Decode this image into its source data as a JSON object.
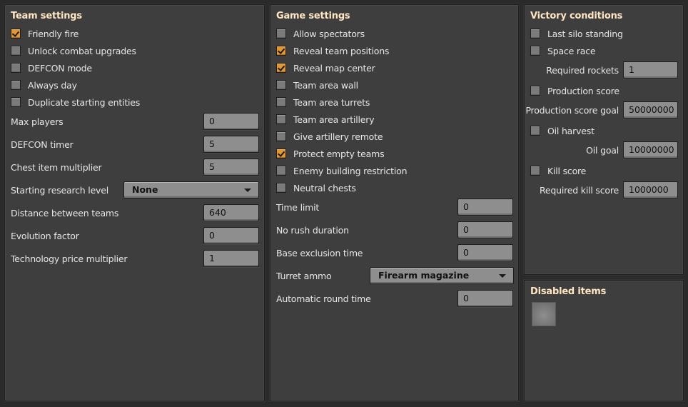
{
  "team_settings": {
    "title": "Team settings",
    "checkboxes": [
      {
        "label": "Friendly fire",
        "checked": true
      },
      {
        "label": "Unlock combat upgrades",
        "checked": false
      },
      {
        "label": "DEFCON mode",
        "checked": false
      },
      {
        "label": "Always day",
        "checked": false
      },
      {
        "label": "Duplicate starting entities",
        "checked": false
      }
    ],
    "fields": [
      {
        "label": "Max players",
        "value": "0"
      },
      {
        "label": "DEFCON timer",
        "value": "5"
      },
      {
        "label": "Chest item multiplier",
        "value": "5"
      },
      {
        "label": "Starting research level",
        "value": "None",
        "type": "dropdown"
      },
      {
        "label": "Distance between teams",
        "value": "640"
      },
      {
        "label": "Evolution factor",
        "value": "0"
      },
      {
        "label": "Technology price multiplier",
        "value": "1"
      }
    ]
  },
  "game_settings": {
    "title": "Game settings",
    "checkboxes": [
      {
        "label": "Allow spectators",
        "checked": false
      },
      {
        "label": "Reveal team positions",
        "checked": true
      },
      {
        "label": "Reveal map center",
        "checked": true
      },
      {
        "label": "Team area wall",
        "checked": false
      },
      {
        "label": "Team area turrets",
        "checked": false
      },
      {
        "label": "Team area artillery",
        "checked": false
      },
      {
        "label": "Give artillery remote",
        "checked": false
      },
      {
        "label": "Protect empty teams",
        "checked": true
      },
      {
        "label": "Enemy building restriction",
        "checked": false
      },
      {
        "label": "Neutral chests",
        "checked": false
      }
    ],
    "fields": [
      {
        "label": "Time limit",
        "value": "0"
      },
      {
        "label": "No rush duration",
        "value": "0"
      },
      {
        "label": "Base exclusion time",
        "value": "0"
      },
      {
        "label": "Turret ammo",
        "value": "Firearm magazine",
        "type": "dropdown"
      },
      {
        "label": "Automatic round time",
        "value": "0"
      }
    ]
  },
  "victory_conditions": {
    "title": "Victory conditions",
    "last_silo": {
      "label": "Last silo standing",
      "checked": false
    },
    "space_race": {
      "label": "Space race",
      "checked": false
    },
    "required_rockets": {
      "label": "Required rockets",
      "value": "1"
    },
    "production_score": {
      "label": "Production score",
      "checked": false
    },
    "production_score_goal": {
      "label": "Production score goal",
      "value": "50000000"
    },
    "oil_harvest": {
      "label": "Oil harvest",
      "checked": false
    },
    "oil_goal": {
      "label": "Oil goal",
      "value": "10000000"
    },
    "kill_score": {
      "label": "Kill score",
      "checked": false
    },
    "required_kill_score": {
      "label": "Required kill score",
      "value": "1000000"
    }
  },
  "disabled_items": {
    "title": "Disabled items",
    "slots": [
      {
        "item": "empty"
      }
    ]
  }
}
